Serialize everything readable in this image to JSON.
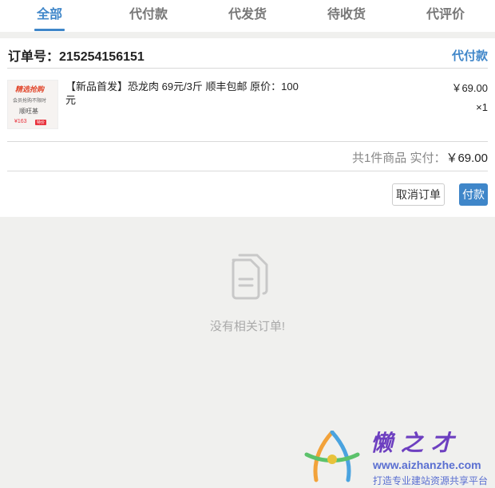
{
  "tabs": [
    {
      "label": "全部",
      "active": true
    },
    {
      "label": "代付款",
      "active": false
    },
    {
      "label": "代发货",
      "active": false
    },
    {
      "label": "待收货",
      "active": false
    },
    {
      "label": "代评价",
      "active": false
    }
  ],
  "order": {
    "number_label": "订单号：215254156151",
    "status": "代付款",
    "product": {
      "thumb_lines": [
        "精选抢购",
        "会员抢购不限时",
        "顺旺基",
        "¥163",
        "特价"
      ],
      "title": "【新品首发】恐龙肉 69元/3斤 顺丰包邮 原价：100元",
      "price": "￥69.00",
      "quantity": "×1"
    },
    "summary": {
      "count_label": "共1件商品 实付：",
      "total": "￥69.00"
    },
    "actions": {
      "cancel_label": "取消订单",
      "pay_label": "付款"
    }
  },
  "empty": {
    "icon": "document-copy-icon",
    "text": "没有相关订单!"
  },
  "watermark": {
    "title": "懒之才",
    "url": "www.aizhanzhe.com",
    "slogan": "打造专业建站资源共享平台"
  },
  "colors": {
    "accent": "#3f86c9",
    "background": "#f0f0ee",
    "muted": "#888888"
  }
}
